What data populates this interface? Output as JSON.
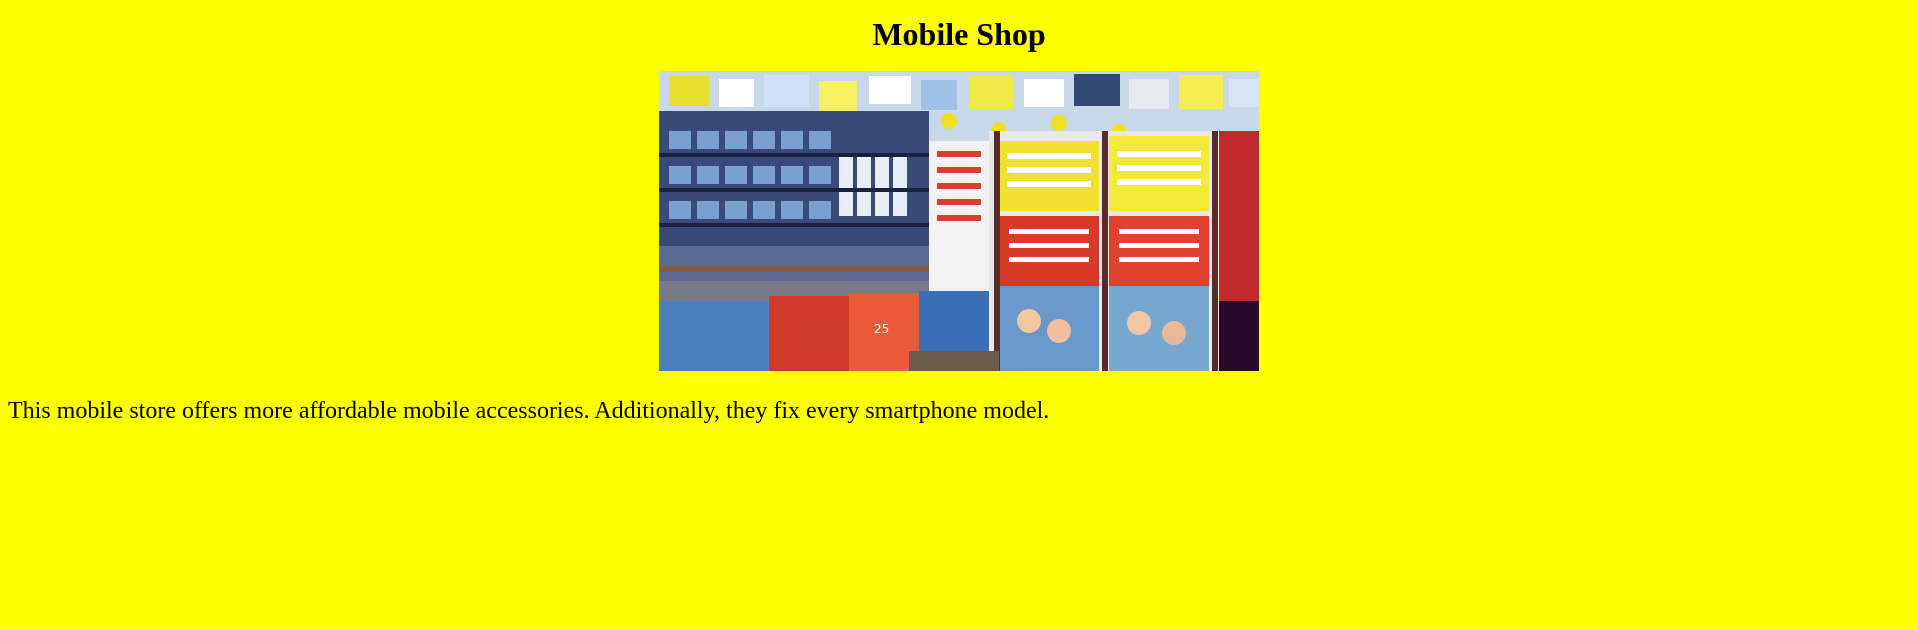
{
  "page": {
    "title": "Mobile Shop",
    "description": "This mobile store offers more affordable mobile accessories. Additionally, they fix every smartphone model."
  },
  "colors": {
    "background": "#ffff00",
    "text": "#000000"
  }
}
